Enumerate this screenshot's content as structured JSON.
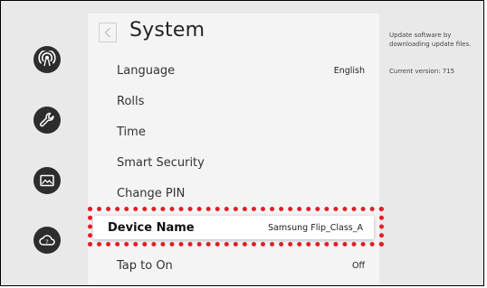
{
  "header": {
    "title": "System"
  },
  "menu": {
    "items": [
      {
        "label": "Language",
        "value": "English"
      },
      {
        "label": "Rolls",
        "value": ""
      },
      {
        "label": "Time",
        "value": ""
      },
      {
        "label": "Smart Security",
        "value": ""
      },
      {
        "label": "Change PIN",
        "value": ""
      },
      {
        "label": "Device Name",
        "value": "Samsung Flip_Class_A",
        "selected": true
      },
      {
        "label": "Tap to On",
        "value": "Off"
      }
    ]
  },
  "info": {
    "description": "Update software by downloading update files.",
    "version": "Current version: 715"
  },
  "rail": {
    "icons": [
      "broadcast-icon",
      "wrench-icon",
      "image-icon",
      "cloud-help-icon"
    ]
  },
  "colors": {
    "highlight": "#e41e25",
    "rail_icon_bg": "#2d2d2d"
  }
}
